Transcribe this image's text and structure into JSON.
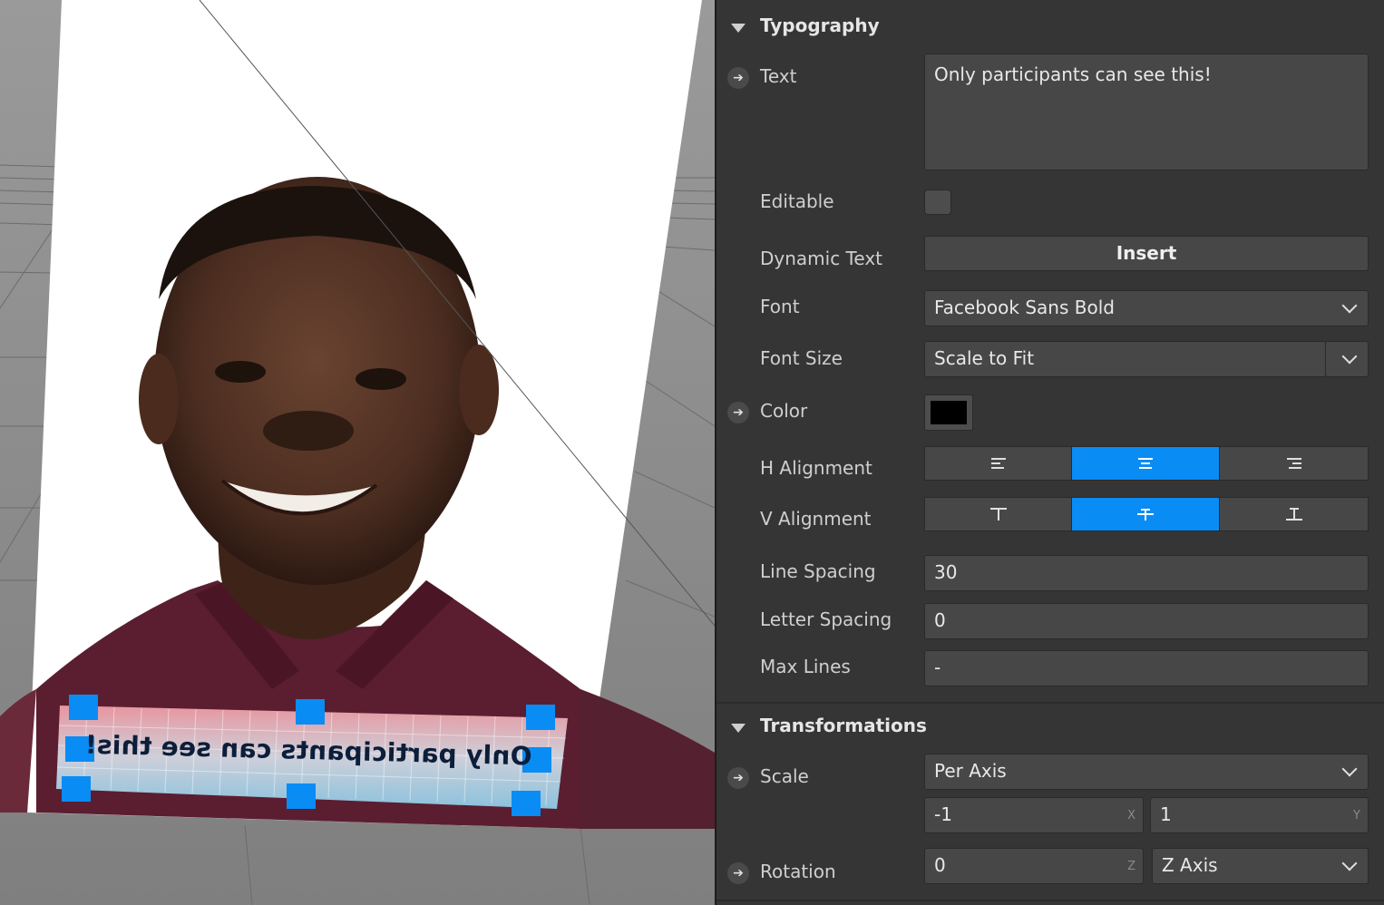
{
  "viewport": {
    "canvas_text": "Only participants can see this!"
  },
  "inspector": {
    "typography": {
      "title": "Typography",
      "text_label": "Text",
      "text_value": "Only participants can see this!",
      "editable_label": "Editable",
      "editable_checked": false,
      "dynamic_text_label": "Dynamic Text",
      "insert_label": "Insert",
      "font_label": "Font",
      "font_value": "Facebook Sans Bold",
      "font_size_label": "Font Size",
      "font_size_value": "Scale to Fit",
      "color_label": "Color",
      "color_value": "#000000",
      "h_alignment_label": "H Alignment",
      "h_alignment_selected": "center",
      "v_alignment_label": "V Alignment",
      "v_alignment_selected": "center",
      "line_spacing_label": "Line Spacing",
      "line_spacing_value": "30",
      "letter_spacing_label": "Letter Spacing",
      "letter_spacing_value": "0",
      "max_lines_label": "Max Lines",
      "max_lines_value": "-"
    },
    "transformations": {
      "title": "Transformations",
      "scale_label": "Scale",
      "scale_mode": "Per Axis",
      "scale_x": "-1",
      "scale_x_axis": "X",
      "scale_y": "1",
      "scale_y_axis": "Y",
      "rotation_label": "Rotation",
      "rotation_value": "0",
      "rotation_axis_tag": "Z",
      "rotation_axis": "Z Axis"
    },
    "accent_color": "#0a8cf5"
  }
}
